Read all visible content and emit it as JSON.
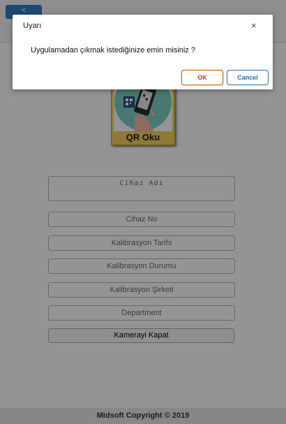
{
  "header": {
    "back_label": "<"
  },
  "qr_card": {
    "label": "QR Oku",
    "icon": "qr-scan-phone-icon"
  },
  "form": {
    "device_name_placeholder": "Cihaz Adı",
    "device_no_placeholder": "Cihaz No",
    "calibration_date_placeholder": "Kalibrasyon Tarihi",
    "calibration_status_placeholder": "Kalibrasyon Durumu",
    "calibration_company_placeholder": "Kalibrasyon Şirketi",
    "department_placeholder": "Department",
    "close_camera_label": "Kamerayi Kapat"
  },
  "footer": {
    "copyright": "Midsoft Copyright © 2019"
  },
  "dialog": {
    "title": "Uyarı",
    "close_symbol": "×",
    "message": "Uygulamadan çıkmak istediğinize emin misiniz ?",
    "ok_label": "OK",
    "cancel_label": "Cancel"
  },
  "colors": {
    "back_button": "#2f7ec8",
    "qr_card": "#f4d35e",
    "ok_border": "#e06a00",
    "cancel_border": "#2c6fad"
  }
}
